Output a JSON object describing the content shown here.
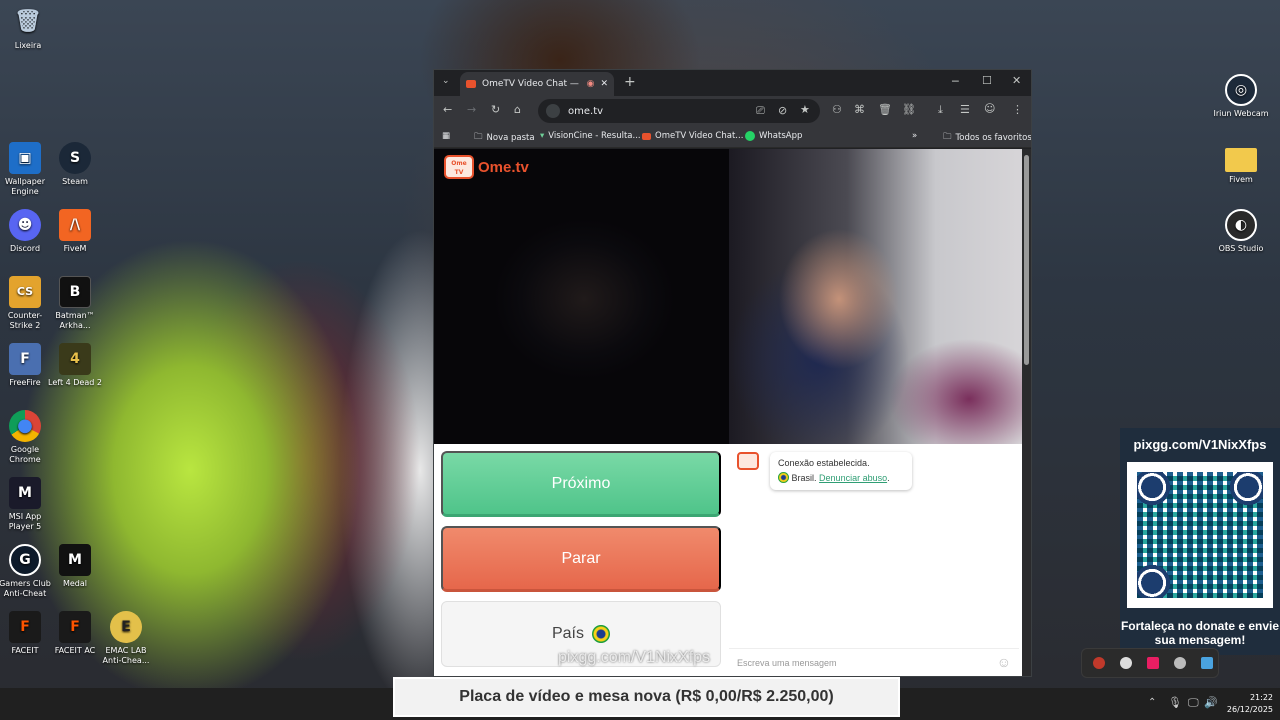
{
  "desktop_icons": [
    {
      "label": "Lixeira",
      "icon": "recycle-bin-icon",
      "color": "#8fb4d8",
      "glyph": "🗑"
    },
    {
      "label": "Wallpaper Engine",
      "icon": "wallpaper-engine-icon",
      "color": "#1e6ec8",
      "glyph": "▣"
    },
    {
      "label": "Steam",
      "icon": "steam-icon",
      "color": "#1b2838",
      "glyph": "S"
    },
    {
      "label": "Discord",
      "icon": "discord-icon",
      "color": "#5865f2",
      "glyph": "☻"
    },
    {
      "label": "FiveM",
      "icon": "fivem-icon",
      "color": "#f26522",
      "glyph": "/\\"
    },
    {
      "label": "Counter-Strike 2",
      "icon": "cs2-icon",
      "color": "#e3a32d",
      "glyph": "CS"
    },
    {
      "label": "Batman™ Arkha...",
      "icon": "batman-icon",
      "color": "#111111",
      "glyph": "B"
    },
    {
      "label": "FreeFire",
      "icon": "freefire-icon",
      "color": "#4a6fb0",
      "glyph": "F"
    },
    {
      "label": "Left 4 Dead 2",
      "icon": "left4dead-icon",
      "color": "#3a3a1a",
      "glyph": "4"
    },
    {
      "label": "Google Chrome",
      "icon": "chrome-icon",
      "color": "#ffffff",
      "glyph": "◉"
    },
    {
      "label": "MSI App Player 5",
      "icon": "msi-app-player-icon",
      "color": "#1a1a2a",
      "glyph": "M"
    },
    {
      "label": "Gamers Club Anti-Cheat",
      "icon": "gamers-club-icon",
      "color": "#0d1a2a",
      "glyph": "G"
    },
    {
      "label": "Medal",
      "icon": "medal-icon",
      "color": "#111111",
      "glyph": "M"
    },
    {
      "label": "FACEIT",
      "icon": "faceit-icon",
      "color": "#1a1a1a",
      "glyph": "F"
    },
    {
      "label": "FACEIT AC",
      "icon": "faceit-ac-icon",
      "color": "#1a1a1a",
      "glyph": "F"
    },
    {
      "label": "EMAC LAB Anti-Chea...",
      "icon": "emac-lab-icon",
      "color": "#e3c04a",
      "glyph": "E"
    },
    {
      "label": "Iriun Webcam",
      "icon": "iriun-webcam-icon",
      "color": "#1d2a3a",
      "glyph": "◎"
    },
    {
      "label": "Fivem",
      "icon": "folder-icon",
      "color": "#f2c94c",
      "glyph": ""
    },
    {
      "label": "OBS Studio",
      "icon": "obs-studio-icon",
      "color": "#2a2a2a",
      "glyph": "◐"
    }
  ],
  "browser": {
    "tab_title": "OmeTV Video Chat — Ome",
    "url": "ome.tv",
    "bookmarks": [
      "Nova pasta",
      "VisionCine - Resulta...",
      "OmeTV Video Chat...",
      "WhatsApp"
    ],
    "all_bookmarks": "Todos os favoritos"
  },
  "page": {
    "logo_text": "Ome.tv",
    "logo_badge": "Ome TV",
    "next_label": "Próximo",
    "stop_label": "Parar",
    "country_label": "País",
    "country_flag": "🇧🇷",
    "chat": {
      "status": "Conexão estabelecida.",
      "country": "Brasil.",
      "report_link": "Denunciar abuso",
      "report_suffix": ".",
      "input_placeholder": "Escreva uma mensagem"
    },
    "watermark": "pixgg.com/V1NixXfps"
  },
  "qr_panel": {
    "url": "pixgg.com/V1NixXfps",
    "message": "Fortaleça no donate e envie sua mensagem!"
  },
  "donation_goal": "Placa de vídeo e mesa nova (R$ 0,00/R$ 2.250,00)",
  "taskbar": {
    "time": "21:22",
    "date": "26/12/2025"
  }
}
